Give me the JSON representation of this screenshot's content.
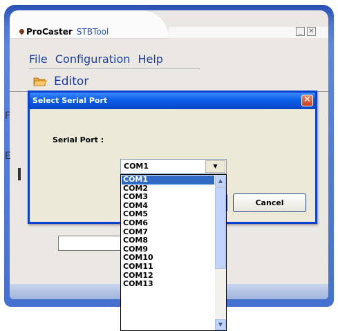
{
  "app": {
    "brand": "ProCaster",
    "subtitle": "STBTool",
    "minimize_glyph": "_",
    "close_glyph": "✕"
  },
  "menu": {
    "items": [
      {
        "label": "File"
      },
      {
        "label": "Configuration"
      },
      {
        "label": "Help"
      }
    ]
  },
  "editor": {
    "label": "Editor",
    "icon": "folder-open-icon"
  },
  "background": {
    "letter_f": "F",
    "letter_e": "E"
  },
  "dialog": {
    "title": "Select Serial Port",
    "close_glyph": "✕",
    "serial_label": "Serial Port :",
    "cancel_label": "Cancel"
  },
  "combo": {
    "value": "COM1",
    "arrow": "▼"
  },
  "dropdown": {
    "selected_index": 0,
    "options": [
      "COM1",
      "COM2",
      "COM3",
      "COM4",
      "COM5",
      "COM6",
      "COM7",
      "COM8",
      "COM9",
      "COM10",
      "COM11",
      "COM12",
      "COM13"
    ],
    "scroll_up": "▲",
    "scroll_down": "▼"
  },
  "colors": {
    "title_blue": "#0a5fe8",
    "menu_text": "#1a3c9e",
    "selection": "#316ac5",
    "close_red": "#c8401f"
  }
}
